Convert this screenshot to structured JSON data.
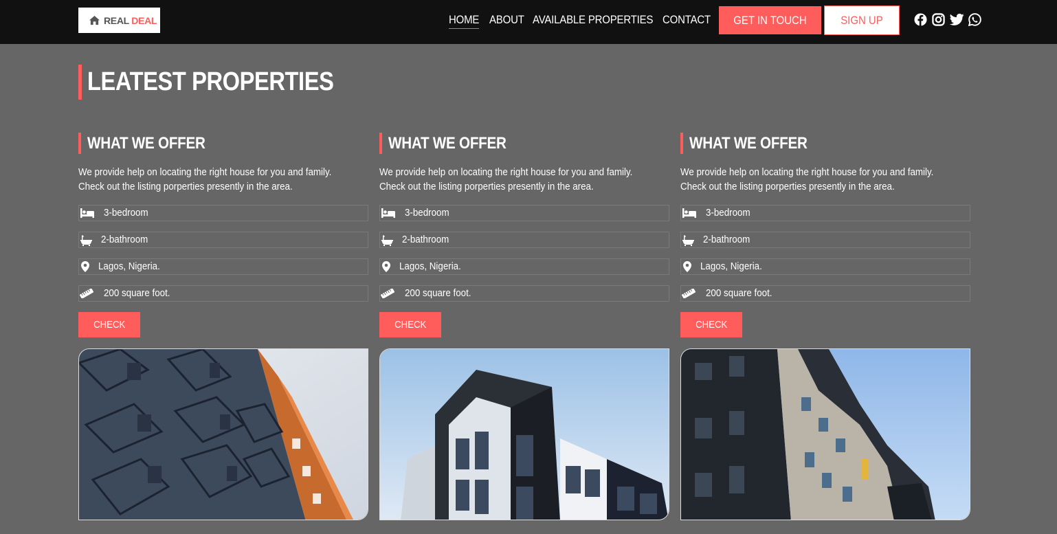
{
  "nav": {
    "logo_real": "REAL",
    "logo_deal": "DEAL",
    "links": [
      "HOME",
      "ABOUT",
      "AVAILABLE PROPERTIES",
      "CONTACT"
    ],
    "get_in_touch": "GET IN TOUCH",
    "sign_up": "SIGN UP",
    "social_icons": [
      "facebook-icon",
      "instagram-icon",
      "twitter-icon",
      "whatsapp-icon"
    ]
  },
  "main": {
    "title": "LEATEST PROPERTIES"
  },
  "cards": [
    {
      "title": "WHAT WE OFFER",
      "description": "We provide help on locating the right house for you and family. Check out the listing porperties presently in the area.",
      "features": [
        "3-bedroom",
        "2-bathroom",
        "Lagos, Nigeria.",
        "200 square foot."
      ],
      "button": "CHECK"
    },
    {
      "title": "WHAT WE OFFER",
      "description": "We provide help on locating the right house for you and family. Check out the listing porperties presently in the area.",
      "features": [
        "3-bedroom",
        "2-bathroom",
        "Lagos, Nigeria.",
        "200 square foot."
      ],
      "button": "CHECK"
    },
    {
      "title": "WHAT WE OFFER",
      "description": "We provide help on locating the right house for you and family. Check out the listing porperties presently in the area.",
      "features": [
        "3-bedroom",
        "2-bathroom",
        "Lagos, Nigeria.",
        "200 square foot."
      ],
      "button": "CHECK"
    }
  ],
  "colors": {
    "accent": "#ff5c5c",
    "navbar_bg": "#111111",
    "page_bg": "#666666"
  }
}
